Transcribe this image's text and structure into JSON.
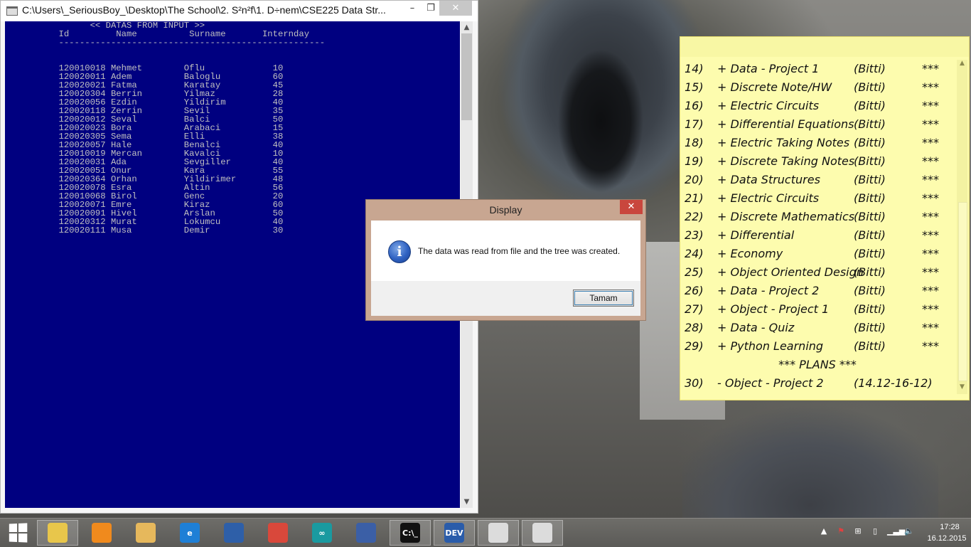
{
  "console": {
    "title": "C:\\Users\\_SeriousBoy_\\Desktop\\The School\\2. S²n²f\\1. D÷nem\\CSE225 Data Str...",
    "header_line": "                << DATAS FROM INPUT >>",
    "columns_line": "          Id         Name          Surname       Internday",
    "rule_line": "          ---------------------------------------------------",
    "rows": [
      "          120010018 Mehmet        Oflu             10",
      "          120020011 Adem          Baloglu          60",
      "          120020021 Fatma         Karatay          45",
      "          120020304 Berrin        Yilmaz           28",
      "          120020056 Ezdin         Yildirim         40",
      "          120020118 Zerrin        Sevil            35",
      "          120020012 Seval         Balci            50",
      "          120020023 Bora          Arabaci          15",
      "          120020305 Sema          Elli             38",
      "          120020057 Hale          Benalci          40",
      "          120010019 Mercan        Kavalci          10",
      "          120020031 Ada           Sevgiller        40",
      "          120020051 Onur          Kara             55",
      "          120020364 Orhan         Yildirimer       48",
      "          120020078 Esra          Altin            56",
      "          120010068 Birol         Genc             20",
      "          120020071 Emre          Kiraz            60",
      "          120020091 Hivel         Arslan           50",
      "          120020312 Murat         Lokumcu          40",
      "          120020111 Musa          Demir            30"
    ],
    "background_color": "#000080",
    "text_color": "#c0c0c0"
  },
  "dialog": {
    "title": "Display",
    "message": "The data was read from file and the tree was created.",
    "ok_label": "Tamam",
    "close_glyph": "✕",
    "icon": "info-icon"
  },
  "sticky_note": {
    "items": [
      {
        "num": "14)",
        "title": "+ Data - Project 1",
        "status": "(Bitti)",
        "stars": "***"
      },
      {
        "num": "15)",
        "title": "+ Discrete Note/HW",
        "status": "(Bitti)",
        "stars": "***"
      },
      {
        "num": "16)",
        "title": "+ Electric Circuits",
        "status": "(Bitti)",
        "stars": "***"
      },
      {
        "num": "17)",
        "title": "+ Differential Equations",
        "status": "(Bitti)",
        "stars": "***"
      },
      {
        "num": "18)",
        "title": "+ Electric Taking Notes",
        "status": "(Bitti)",
        "stars": "***"
      },
      {
        "num": "19)",
        "title": "+ Discrete Taking Notes",
        "status": "(Bitti)",
        "stars": "***"
      },
      {
        "num": "20)",
        "title": "+ Data Structures",
        "status": "(Bitti)",
        "stars": "***"
      },
      {
        "num": "21)",
        "title": "+ Electric Circuits",
        "status": "(Bitti)",
        "stars": "***"
      },
      {
        "num": "22)",
        "title": "+ Discrete Mathematics",
        "status": "(Bitti)",
        "stars": "***"
      },
      {
        "num": "23)",
        "title": "+ Differential",
        "status": "(Bitti)",
        "stars": "***"
      },
      {
        "num": "24)",
        "title": "+ Economy",
        "status": "(Bitti)",
        "stars": "***"
      },
      {
        "num": "25)",
        "title": "+ Object Oriented Design",
        "status": "(Bitti)",
        "stars": "***"
      },
      {
        "num": "26)",
        "title": "+ Data - Project 2",
        "status": "(Bitti)",
        "stars": "***"
      },
      {
        "num": "27)",
        "title": "+ Object - Project 1",
        "status": "(Bitti)",
        "stars": "***"
      },
      {
        "num": "28)",
        "title": "+ Data - Quiz",
        "status": "(Bitti)",
        "stars": "***"
      },
      {
        "num": "29)",
        "title": "+ Python Learning",
        "status": "(Bitti)",
        "stars": "***"
      }
    ],
    "plans_header": "*** PLANS ***",
    "plans": [
      {
        "num": "30)",
        "title": "- Object - Project 2",
        "status": "(14.12-16-12)",
        "stars": ""
      }
    ],
    "background_color": "#fdfcae"
  },
  "taskbar": {
    "pinned": [
      {
        "name": "file-explorer-icon",
        "label": "",
        "color": "#e8c64b"
      },
      {
        "name": "browser-orange-icon",
        "label": "",
        "color": "#f08a1d"
      },
      {
        "name": "folder-icon",
        "label": "",
        "color": "#e6b85c"
      },
      {
        "name": "internet-explorer-icon",
        "label": "e",
        "color": "#1e7fd6"
      },
      {
        "name": "firefox-icon",
        "label": "",
        "color": "#2e5fa8"
      },
      {
        "name": "chrome-icon",
        "label": "",
        "color": "#d9483b"
      },
      {
        "name": "arduino-icon",
        "label": "∞",
        "color": "#1a9aa0"
      },
      {
        "name": "text-editor-icon",
        "label": "",
        "color": "#3b5fa6"
      },
      {
        "name": "cmd-icon",
        "label": "C:\\_",
        "color": "#111111"
      },
      {
        "name": "dev-cpp-icon",
        "label": "DEV",
        "color": "#2a5caa"
      },
      {
        "name": "sticky-notes-icon-1",
        "label": "",
        "color": "#dcdcdc"
      },
      {
        "name": "sticky-notes-icon-2",
        "label": "",
        "color": "#dcdcdc"
      }
    ],
    "clock_time": "17:28",
    "clock_date": "16.12.2015"
  },
  "window_buttons": {
    "minimize": "–",
    "maximize": "❐",
    "close": "✕"
  }
}
